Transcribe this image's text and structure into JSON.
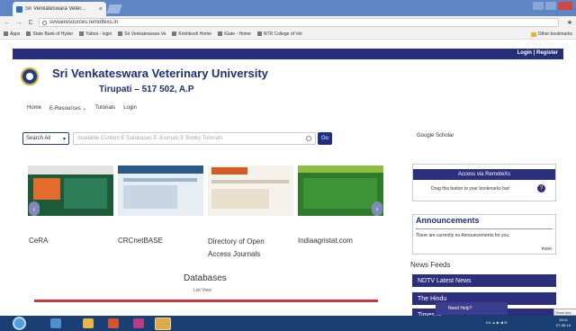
{
  "browser": {
    "tab_title": "Sri Venkateswara Veter...",
    "tab_close": "×",
    "url": "svvueresources.remotlexs.in",
    "back_icon": "←",
    "forward_icon": "→",
    "reload_icon": "C",
    "star_icon": "★",
    "bookmarks": [
      "Apps",
      "State Bank of Hyder",
      "Yahoo - login",
      "Sri Venkateswara Ve",
      "Krishkosh Home",
      "iGate - Home",
      "NTR College of Vet"
    ],
    "other_bookmarks": "Other bookmarks"
  },
  "header": {
    "login_register": "Login | Register",
    "title": "Sri Venkateswara Veterinary University",
    "subtitle": "Tirupati – 517 502, A.P"
  },
  "nav": {
    "items": [
      "Home",
      "E-Resources ⌄",
      "Tutorials",
      "Login"
    ]
  },
  "search": {
    "select_value": "Search All",
    "select_caret": "▾",
    "placeholder": "Available Content E Databases E Journals E Books Tutorials",
    "go_label": "Go"
  },
  "google_scholar": "Google Scholar",
  "carousel": {
    "prev_icon": "‹",
    "next_icon": "›",
    "items": [
      {
        "label": "CeRA"
      },
      {
        "label": "CRCnetBASE"
      },
      {
        "label": "Directory of Open Access Journals"
      },
      {
        "label": "Indiaagristat.com"
      }
    ]
  },
  "databases": {
    "title": "Databases",
    "list_view": "List View"
  },
  "remotexs": {
    "button": "Access via RemoteXs",
    "hint": "Drag this button to your bookmarks bar!",
    "help": "?"
  },
  "announcements": {
    "title": "Announcements",
    "text": "There are currently no Announcements for you.",
    "more": "more"
  },
  "news": {
    "title": "News Feeds",
    "items": [
      "NDTV Latest News",
      "The Hindu",
      "Times of"
    ]
  },
  "need_help": "Need Help?",
  "tooltip": "Show des",
  "taskbar": {
    "tray": "EN ▲  ▶ ◀ ✉",
    "time": "15:01",
    "date": "07-08-16"
  },
  "colors": {
    "brand_navy": "#26307a",
    "accent_red": "#c83a3a"
  }
}
